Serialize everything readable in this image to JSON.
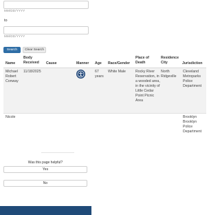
{
  "filters": {
    "from_date": {
      "value": "",
      "hint": "MM/DD/YYYY"
    },
    "to_label": "to",
    "to_date": {
      "value": "",
      "hint": "MM/DD/YYYY"
    },
    "search_label": "Search",
    "clear_label": "Clear Search"
  },
  "table": {
    "headers": {
      "name": "Name",
      "body_received": "Body Received",
      "cause": "Cause",
      "manner": "Manner",
      "age": "Age",
      "race_gender": "Race/Gender",
      "place_of_death": "Place of Death",
      "residence_city": "Residence City",
      "jurisdiction": "Jurisdiction"
    },
    "rows": [
      {
        "name": "Michael Robert Conway",
        "body_received": "11/18/2025",
        "cause": "",
        "manner_icon": "accessibility-icon",
        "age": "67 years",
        "race_gender": "White Male",
        "place_of_death": "Rocky River Reservation, in a wooded area, in the vicinity of Little Cedar Point Picnic Area",
        "residence_city": "North Ridgeville",
        "jurisdiction": "Cleveland Metroparks Police Department"
      },
      {
        "name": "Nicole",
        "residence_city": "Brooklyn",
        "jurisdiction": "Brooklyn Police Department"
      }
    ]
  },
  "feedback": {
    "question": "Was this page helpful?",
    "yes_label": "Yes",
    "no_label": "No"
  },
  "colors": {
    "primary": "#2f6ea6",
    "manner_badge": "#22487a",
    "footer": "#1f4a78"
  }
}
